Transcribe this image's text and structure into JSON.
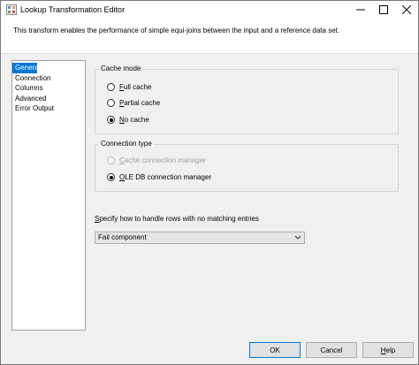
{
  "window": {
    "title": "Lookup Transformation Editor",
    "description": "This transform enables the performance of simple equi-joins between the input and a reference data set."
  },
  "nav": {
    "items": [
      {
        "label": "General",
        "selected": true
      },
      {
        "label": "Connection",
        "selected": false
      },
      {
        "label": "Columns",
        "selected": false
      },
      {
        "label": "Advanced",
        "selected": false
      },
      {
        "label": "Error Output",
        "selected": false
      }
    ]
  },
  "cache_mode": {
    "legend": "Cache mode",
    "options": [
      {
        "label": "Full cache",
        "accel": "F",
        "rest": "ull cache",
        "checked": false
      },
      {
        "label": "Partial cache",
        "accel": "P",
        "rest": "artial cache",
        "checked": false
      },
      {
        "label": "No cache",
        "accel": "N",
        "rest": "o cache",
        "checked": true
      }
    ]
  },
  "connection_type": {
    "legend": "Connection type",
    "options": [
      {
        "label": "Cache connection manager",
        "accel": "C",
        "rest": "ache connection manager",
        "checked": false,
        "disabled": true
      },
      {
        "label": "OLE DB connection manager",
        "accel": "O",
        "rest": "LE DB connection manager",
        "checked": true,
        "disabled": false
      }
    ]
  },
  "no_match": {
    "label": "Specify how to handle rows with no matching entries",
    "accel": "S",
    "rest": "pecify how to handle rows with no matching entries",
    "selected": "Fail component"
  },
  "buttons": {
    "ok": "OK",
    "cancel": "Cancel",
    "help_accel": "H",
    "help_rest": "elp"
  },
  "colors": {
    "selection": "#0078d7",
    "dialog_bg": "#f0f0f0"
  }
}
